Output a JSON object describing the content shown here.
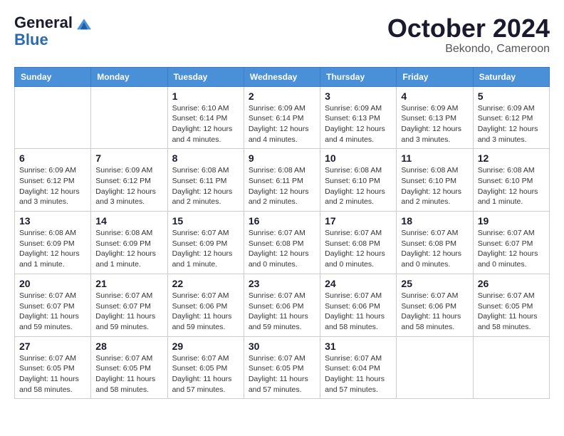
{
  "header": {
    "logo_line1": "General",
    "logo_line2": "Blue",
    "month_title": "October 2024",
    "location": "Bekondo, Cameroon"
  },
  "days_of_week": [
    "Sunday",
    "Monday",
    "Tuesday",
    "Wednesday",
    "Thursday",
    "Friday",
    "Saturday"
  ],
  "weeks": [
    [
      {
        "day": "",
        "info": ""
      },
      {
        "day": "",
        "info": ""
      },
      {
        "day": "1",
        "info": "Sunrise: 6:10 AM\nSunset: 6:14 PM\nDaylight: 12 hours\nand 4 minutes."
      },
      {
        "day": "2",
        "info": "Sunrise: 6:09 AM\nSunset: 6:14 PM\nDaylight: 12 hours\nand 4 minutes."
      },
      {
        "day": "3",
        "info": "Sunrise: 6:09 AM\nSunset: 6:13 PM\nDaylight: 12 hours\nand 4 minutes."
      },
      {
        "day": "4",
        "info": "Sunrise: 6:09 AM\nSunset: 6:13 PM\nDaylight: 12 hours\nand 3 minutes."
      },
      {
        "day": "5",
        "info": "Sunrise: 6:09 AM\nSunset: 6:12 PM\nDaylight: 12 hours\nand 3 minutes."
      }
    ],
    [
      {
        "day": "6",
        "info": "Sunrise: 6:09 AM\nSunset: 6:12 PM\nDaylight: 12 hours\nand 3 minutes."
      },
      {
        "day": "7",
        "info": "Sunrise: 6:09 AM\nSunset: 6:12 PM\nDaylight: 12 hours\nand 3 minutes."
      },
      {
        "day": "8",
        "info": "Sunrise: 6:08 AM\nSunset: 6:11 PM\nDaylight: 12 hours\nand 2 minutes."
      },
      {
        "day": "9",
        "info": "Sunrise: 6:08 AM\nSunset: 6:11 PM\nDaylight: 12 hours\nand 2 minutes."
      },
      {
        "day": "10",
        "info": "Sunrise: 6:08 AM\nSunset: 6:10 PM\nDaylight: 12 hours\nand 2 minutes."
      },
      {
        "day": "11",
        "info": "Sunrise: 6:08 AM\nSunset: 6:10 PM\nDaylight: 12 hours\nand 2 minutes."
      },
      {
        "day": "12",
        "info": "Sunrise: 6:08 AM\nSunset: 6:10 PM\nDaylight: 12 hours\nand 1 minute."
      }
    ],
    [
      {
        "day": "13",
        "info": "Sunrise: 6:08 AM\nSunset: 6:09 PM\nDaylight: 12 hours\nand 1 minute."
      },
      {
        "day": "14",
        "info": "Sunrise: 6:08 AM\nSunset: 6:09 PM\nDaylight: 12 hours\nand 1 minute."
      },
      {
        "day": "15",
        "info": "Sunrise: 6:07 AM\nSunset: 6:09 PM\nDaylight: 12 hours\nand 1 minute."
      },
      {
        "day": "16",
        "info": "Sunrise: 6:07 AM\nSunset: 6:08 PM\nDaylight: 12 hours\nand 0 minutes."
      },
      {
        "day": "17",
        "info": "Sunrise: 6:07 AM\nSunset: 6:08 PM\nDaylight: 12 hours\nand 0 minutes."
      },
      {
        "day": "18",
        "info": "Sunrise: 6:07 AM\nSunset: 6:08 PM\nDaylight: 12 hours\nand 0 minutes."
      },
      {
        "day": "19",
        "info": "Sunrise: 6:07 AM\nSunset: 6:07 PM\nDaylight: 12 hours\nand 0 minutes."
      }
    ],
    [
      {
        "day": "20",
        "info": "Sunrise: 6:07 AM\nSunset: 6:07 PM\nDaylight: 11 hours\nand 59 minutes."
      },
      {
        "day": "21",
        "info": "Sunrise: 6:07 AM\nSunset: 6:07 PM\nDaylight: 11 hours\nand 59 minutes."
      },
      {
        "day": "22",
        "info": "Sunrise: 6:07 AM\nSunset: 6:06 PM\nDaylight: 11 hours\nand 59 minutes."
      },
      {
        "day": "23",
        "info": "Sunrise: 6:07 AM\nSunset: 6:06 PM\nDaylight: 11 hours\nand 59 minutes."
      },
      {
        "day": "24",
        "info": "Sunrise: 6:07 AM\nSunset: 6:06 PM\nDaylight: 11 hours\nand 58 minutes."
      },
      {
        "day": "25",
        "info": "Sunrise: 6:07 AM\nSunset: 6:06 PM\nDaylight: 11 hours\nand 58 minutes."
      },
      {
        "day": "26",
        "info": "Sunrise: 6:07 AM\nSunset: 6:05 PM\nDaylight: 11 hours\nand 58 minutes."
      }
    ],
    [
      {
        "day": "27",
        "info": "Sunrise: 6:07 AM\nSunset: 6:05 PM\nDaylight: 11 hours\nand 58 minutes."
      },
      {
        "day": "28",
        "info": "Sunrise: 6:07 AM\nSunset: 6:05 PM\nDaylight: 11 hours\nand 58 minutes."
      },
      {
        "day": "29",
        "info": "Sunrise: 6:07 AM\nSunset: 6:05 PM\nDaylight: 11 hours\nand 57 minutes."
      },
      {
        "day": "30",
        "info": "Sunrise: 6:07 AM\nSunset: 6:05 PM\nDaylight: 11 hours\nand 57 minutes."
      },
      {
        "day": "31",
        "info": "Sunrise: 6:07 AM\nSunset: 6:04 PM\nDaylight: 11 hours\nand 57 minutes."
      },
      {
        "day": "",
        "info": ""
      },
      {
        "day": "",
        "info": ""
      }
    ]
  ]
}
